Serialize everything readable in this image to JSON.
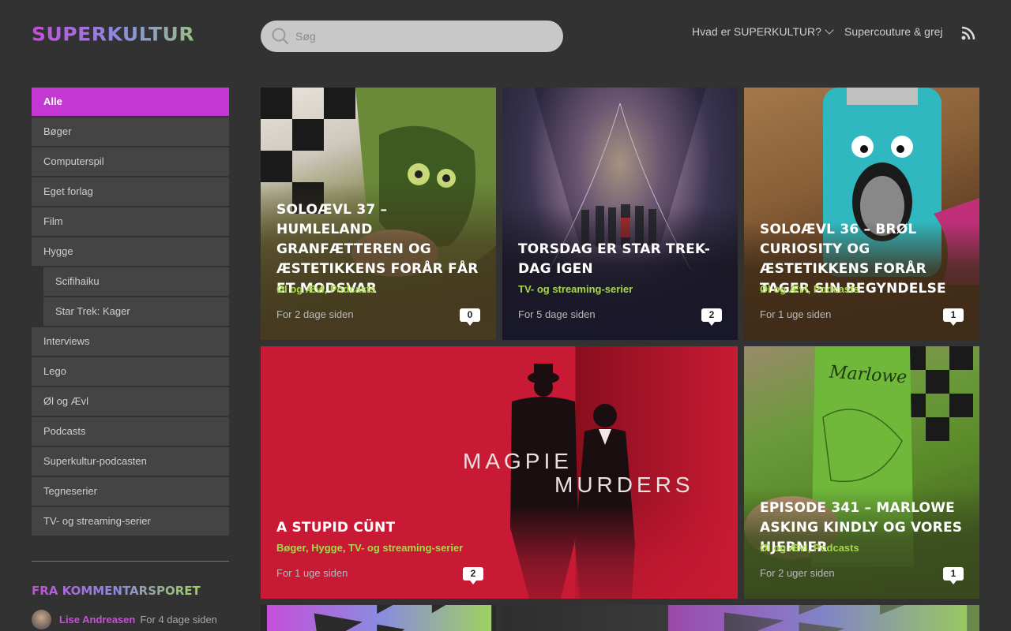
{
  "header": {
    "logo_text": "SUPERKULTUR",
    "search_placeholder": "Søg",
    "nav": [
      {
        "label": "Hvad er SUPERKULTUR?"
      },
      {
        "label": "Supercouture & grej"
      }
    ]
  },
  "sidebar": {
    "items": [
      {
        "label": "Alle"
      },
      {
        "label": "Bøger"
      },
      {
        "label": "Computerspil"
      },
      {
        "label": "Eget forlag"
      },
      {
        "label": "Film"
      },
      {
        "label": "Hygge"
      },
      {
        "label": "Scifihaiku"
      },
      {
        "label": "Star Trek: Kager"
      },
      {
        "label": "Interviews"
      },
      {
        "label": "Lego"
      },
      {
        "label": "Øl og Ævl"
      },
      {
        "label": "Podcasts"
      },
      {
        "label": "Superkultur-podcasten"
      },
      {
        "label": "Tegneserier"
      },
      {
        "label": "TV- og streaming-serier"
      }
    ],
    "comments_heading": "FRA KOMMENTARSPORET",
    "comment": {
      "author": "Lise Andreasen",
      "time": "For 4 dage siden"
    }
  },
  "posts": [
    {
      "title": "Soloævl 37 – Humleland Granfætteren og æstetikkens forår får et modsvar",
      "cats": [
        "Øl og Ævl",
        "Podcasts"
      ],
      "date": "For 2 dage siden",
      "comments": "0"
    },
    {
      "title": "Torsdag er Star Trek-dag igen",
      "cats": [
        "TV- og streaming-serier"
      ],
      "date": "For 5 dage siden",
      "comments": "2"
    },
    {
      "title": "Soloævl 36 – Brøl Curiosity og æstetikkens forår tager sin begyndelse",
      "cats": [
        "Øl og Ævl",
        "Podcasts"
      ],
      "date": "For 1 uge siden",
      "comments": "1"
    },
    {
      "title": "A Stupid Cünt",
      "cats": [
        "Bøger",
        "Hygge",
        "TV- og streaming-serier"
      ],
      "date": "For 1 uge siden",
      "comments": "2",
      "image_text": [
        "MAGPIE",
        "MURDERS"
      ]
    },
    {
      "title": "Episode 341 – Marlowe asking kindly og vores hjerner",
      "cats": [
        "Øl og Ævl",
        "Podcasts"
      ],
      "date": "For 2 uger siden",
      "comments": "1",
      "image_text": "Marlowe"
    }
  ],
  "colors": {
    "accent": "#c537d2",
    "category": "#a8d84a",
    "background": "#323232"
  }
}
